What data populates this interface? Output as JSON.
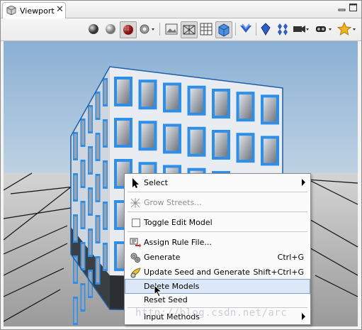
{
  "tab": {
    "title": "Viewport",
    "close": "✕"
  },
  "toolbar": {
    "icons": [
      "shade-dark-sphere-icon",
      "shade-light-sphere-icon",
      "textured-sphere-icon",
      "lighting-settings-icon",
      "wireframe-image-icon",
      "wireframe-toggle-icon",
      "grid-icon",
      "model-cube-icon",
      "shield-icon",
      "gem-icon",
      "multi-gem-icon",
      "camera-icon",
      "bookmarks-icon",
      "star-icon"
    ]
  },
  "menu": {
    "items": [
      {
        "label": "Select",
        "shortcut": "",
        "submenu": true,
        "disabled": false
      },
      {
        "label": "Grow Streets...",
        "shortcut": "",
        "submenu": false,
        "disabled": true
      },
      {
        "label": "Toggle Edit Model",
        "shortcut": "",
        "submenu": false,
        "disabled": false
      },
      {
        "label": "Assign Rule File...",
        "shortcut": "",
        "submenu": false,
        "disabled": false
      },
      {
        "label": "Generate",
        "shortcut": "Ctrl+G",
        "submenu": false,
        "disabled": false
      },
      {
        "label": "Update Seed and Generate",
        "shortcut": "Shift+Ctrl+G",
        "submenu": false,
        "disabled": false
      },
      {
        "label": "Delete Models",
        "shortcut": "",
        "submenu": false,
        "disabled": false,
        "highlighted": true
      },
      {
        "label": "Reset Seed",
        "shortcut": "",
        "submenu": false,
        "disabled": false
      },
      {
        "label": "Input Methods",
        "shortcut": "",
        "submenu": true,
        "disabled": false
      }
    ]
  },
  "watermark": "http://blog.csdn.net/arc",
  "colors": {
    "accent": "#2f8fe8",
    "highlight": "#dce8f8"
  }
}
